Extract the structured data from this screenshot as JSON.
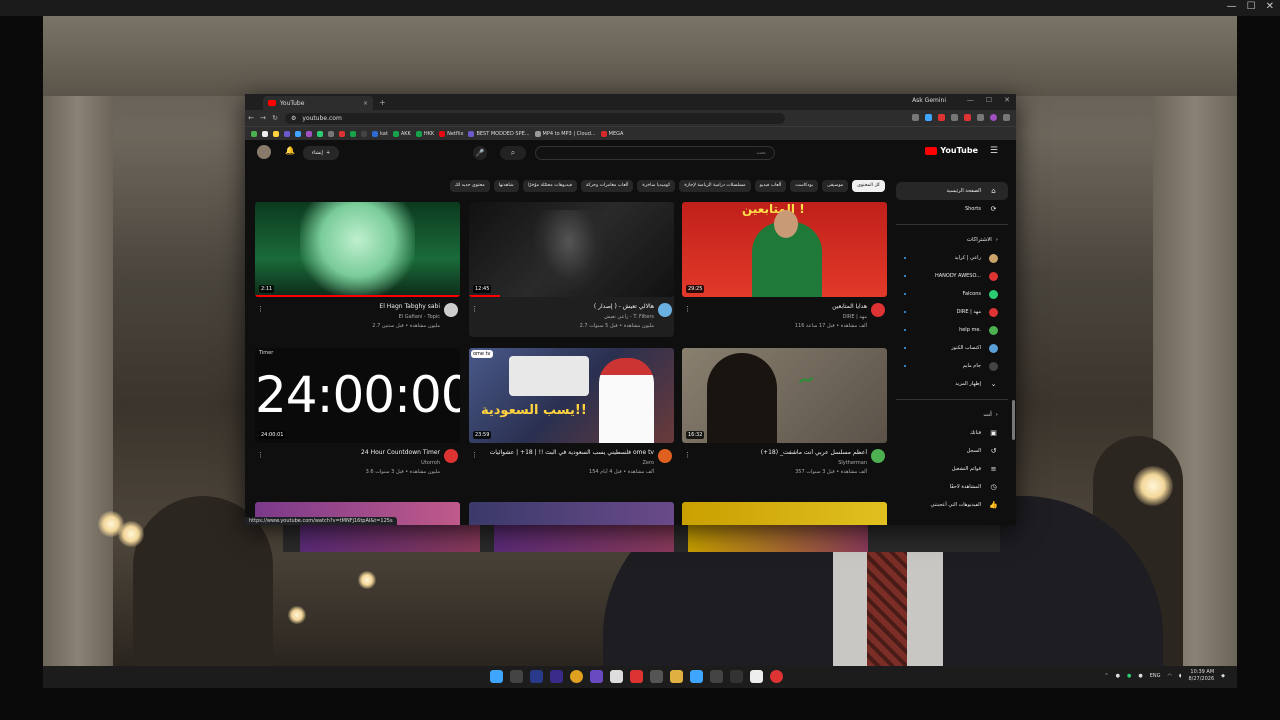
{
  "browser": {
    "tab_title": "YouTube",
    "tab_close": "×",
    "new_tab": "+",
    "gemini_label": "Ask Gemini",
    "url": "youtube.com",
    "status_url": "https://www.youtube.com/watch?v=tMNFj16tpAI&t=125s",
    "bookmarks": [
      {
        "label": "kat",
        "color": "#2f6bd6"
      },
      {
        "label": "AKK",
        "color": "#18a34a"
      },
      {
        "label": "HKK",
        "color": "#18a34a"
      },
      {
        "label": "Netflix",
        "color": "#e50914"
      },
      {
        "label": "BEST MODDED SPE...",
        "color": "#6a5acd"
      },
      {
        "label": "MP4 to MP3 | Cloud...",
        "color": "#999999"
      },
      {
        "label": "MEGA",
        "color": "#d9272e"
      }
    ]
  },
  "youtube": {
    "logo": "YouTube",
    "search_placeholder": "بحث",
    "create_label": "إنشاء",
    "chips": [
      {
        "label": "محتوى جديد لك",
        "active": false
      },
      {
        "label": "شاهدتها",
        "active": false
      },
      {
        "label": "فيديوهات محمّلة مؤخرًا",
        "active": false
      },
      {
        "label": "ألعاب مغامرات وحركة",
        "active": false
      },
      {
        "label": "كوميديا ساخرة",
        "active": false
      },
      {
        "label": "مسلسلات درامية الرياضة لإجازة",
        "active": false
      },
      {
        "label": "ألعاب فيديو",
        "active": false
      },
      {
        "label": "بودكاست",
        "active": false
      },
      {
        "label": "موسيقى",
        "active": false
      },
      {
        "label": "كل المحتوى",
        "active": true
      }
    ],
    "sidebar": {
      "home": "الصفحة الرئيسية",
      "shorts": "Shorts",
      "subscriptions_head": "الاشتراكات",
      "subscriptions": [
        {
          "label": "راعي | كرايد",
          "color": "#c9a36a"
        },
        {
          "label": "HANODY AWESO...",
          "color": "#d33"
        },
        {
          "label": "Falcons",
          "color": "#2ecc71"
        },
        {
          "label": "DIRE | مهد",
          "color": "#d33"
        },
        {
          "label": "help me.",
          "color": "#4caf50"
        },
        {
          "label": "اكتساب الكنوز",
          "color": "#5aa0d8"
        },
        {
          "label": "جام مايم",
          "color": "#444"
        }
      ],
      "show_more": "إظهار المزيد",
      "you_head": "أنت",
      "you_items": [
        {
          "label": "قناتك",
          "icon": "▣"
        },
        {
          "label": "السجل",
          "icon": "↺"
        },
        {
          "label": "قوائم التشغيل",
          "icon": "≡"
        },
        {
          "label": "المشاهدة لاحقًا",
          "icon": "◷"
        },
        {
          "label": "الفيديوهات التي أعجبتني",
          "icon": "👍"
        }
      ]
    },
    "videos": [
      {
        "title": "El Hagn Tabghy sabi",
        "channel": "El Gafiani - Topic",
        "stats": "2.7 مليون مشاهدة • قبل سنتين",
        "duration": "2:11",
        "avatar": "#ccc"
      },
      {
        "title": "هالالي تعيش - ( إصدار )",
        "channel": "راعي تعيش - T. Filters",
        "stats": "2.7 مليون مشاهدة • قبل 5 سنوات",
        "duration": "12:45",
        "avatar": "#6ab0e0"
      },
      {
        "title": "هدايا المتابعين",
        "channel": "DIRE | مهد",
        "stats": "116 ألف مشاهدة • قبل 17 ساعة",
        "duration": "29:25",
        "avatar": "#d33"
      },
      {
        "title": "24 Hour Countdown Timer",
        "channel": "Utorroh",
        "stats": "3.6 مليون مشاهدة • قبل 3 سنوات",
        "duration": "24:00:01",
        "avatar": "#d33"
      },
      {
        "title": "فلسطيني يسب السعودية في البث !! | 18+ | عشوائيات ome tv",
        "channel": "Zero",
        "stats": "154 ألف مشاهدة • قبل 4 أيام",
        "duration": "23:59",
        "avatar": "#e06020"
      },
      {
        "title": "أعظم مسلسل عربي أنت ماشفت_ (18+)",
        "channel": "Slytherman",
        "stats": "357 ألف مشاهدة • قبل 3 سنوات",
        "duration": "16:32",
        "avatar": "#4caf50"
      }
    ],
    "clock_text": "24:00:00",
    "clock_brand": "Timer",
    "ome_badge": "ome tv",
    "thumb3_text": "المتابعين !",
    "thumb5_text": "يسب السعودية!!"
  },
  "taskbar": {
    "language": "ENG",
    "time": "10:39 AM",
    "date": "8/27/2026"
  }
}
